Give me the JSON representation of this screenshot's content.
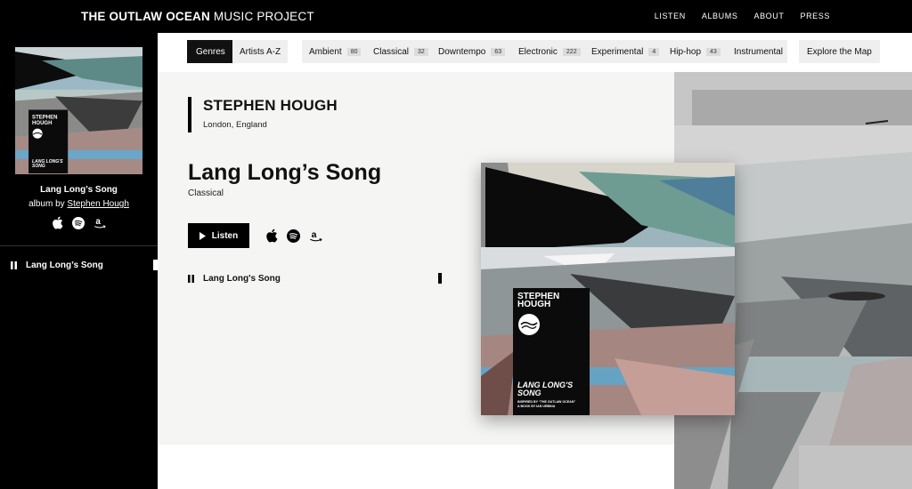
{
  "header": {
    "brand_bold": "THE OUTLAW OCEAN",
    "brand_regular": "MUSIC PROJECT",
    "nav": [
      "LISTEN",
      "ALBUMS",
      "ABOUT",
      "PRESS"
    ]
  },
  "sidebar": {
    "album_title": "Lang Long’s Song",
    "album_by": "album by",
    "artist_link": "Stephen Hough",
    "icons": [
      "apple-icon",
      "spotify-icon",
      "amazon-icon"
    ],
    "now_playing": "Lang Long’s Song"
  },
  "filters": {
    "tabs": [
      "Genres",
      "Artists A-Z"
    ],
    "genres": [
      {
        "label": "Ambient",
        "count": "80"
      },
      {
        "label": "Classical",
        "count": "32"
      },
      {
        "label": "Downtempo",
        "count": "63"
      },
      {
        "label": "Electronic",
        "count": "222"
      },
      {
        "label": "Experimental",
        "count": "4"
      },
      {
        "label": "Hip-hop",
        "count": "43"
      },
      {
        "label": "Instrumental",
        "count": ""
      }
    ],
    "explore": "Explore the Map"
  },
  "main": {
    "artist": "STEPHEN HOUGH",
    "location": "London, England",
    "album_title": "Lang Long’s Song",
    "genre": "Classical",
    "listen_label": "Listen",
    "tracks": [
      {
        "title": "Lang Long's Song"
      }
    ]
  },
  "cover": {
    "artist_line1": "STEPHEN",
    "artist_line2": "HOUGH",
    "title_line1": "LANG LONG'S",
    "title_line2": "SONG",
    "caption_line1": "INSPIRED BY “THE OUTLAW OCEAN”",
    "caption_line2": "A BOOK BY IAN URBINA"
  },
  "colors": {
    "black": "#000000",
    "panel_bg": "#f5f5f4",
    "chip_bg": "#efefef"
  }
}
